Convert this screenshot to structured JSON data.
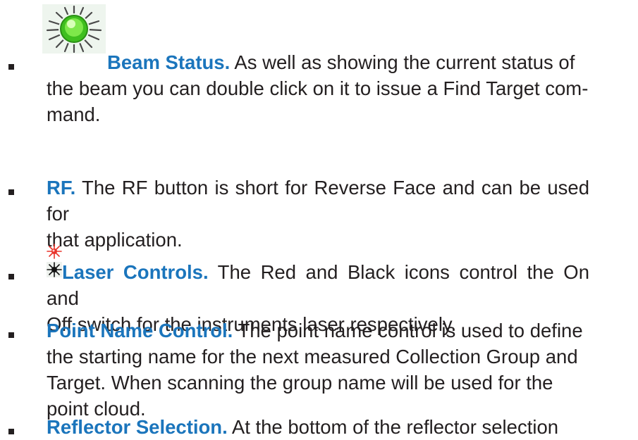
{
  "items": [
    {
      "icon": "beam-status-green-led-icon",
      "term": "Beam Status.",
      "line1": " As well as showing the current status of",
      "line2": "the beam you can double click on it to issue a Find Target com-",
      "line3": "mand."
    },
    {
      "term": "RF.",
      "line1": " The RF button is short for Reverse Face and can be used for",
      "line2": "that application."
    },
    {
      "icons": [
        "laser-on-red-icon",
        "laser-off-black-icon"
      ],
      "term": "Laser Controls.",
      "line1": " The Red and Black icons control the On and",
      "line2": "Off switch for the instruments laser respectively."
    },
    {
      "term": "Point Name Control.",
      "line1": " The point name control is used to define",
      "line2": "the starting name for the next measured Collection Group and",
      "line3": "Target. When scanning the group name will be used for the",
      "line4": "point cloud."
    },
    {
      "term": "Reflector Selection.",
      "line1": " At the bottom of the reflector selection"
    }
  ],
  "colors": {
    "term": "#1b75bc",
    "text": "#231f20",
    "beam": "#4cd02a"
  }
}
